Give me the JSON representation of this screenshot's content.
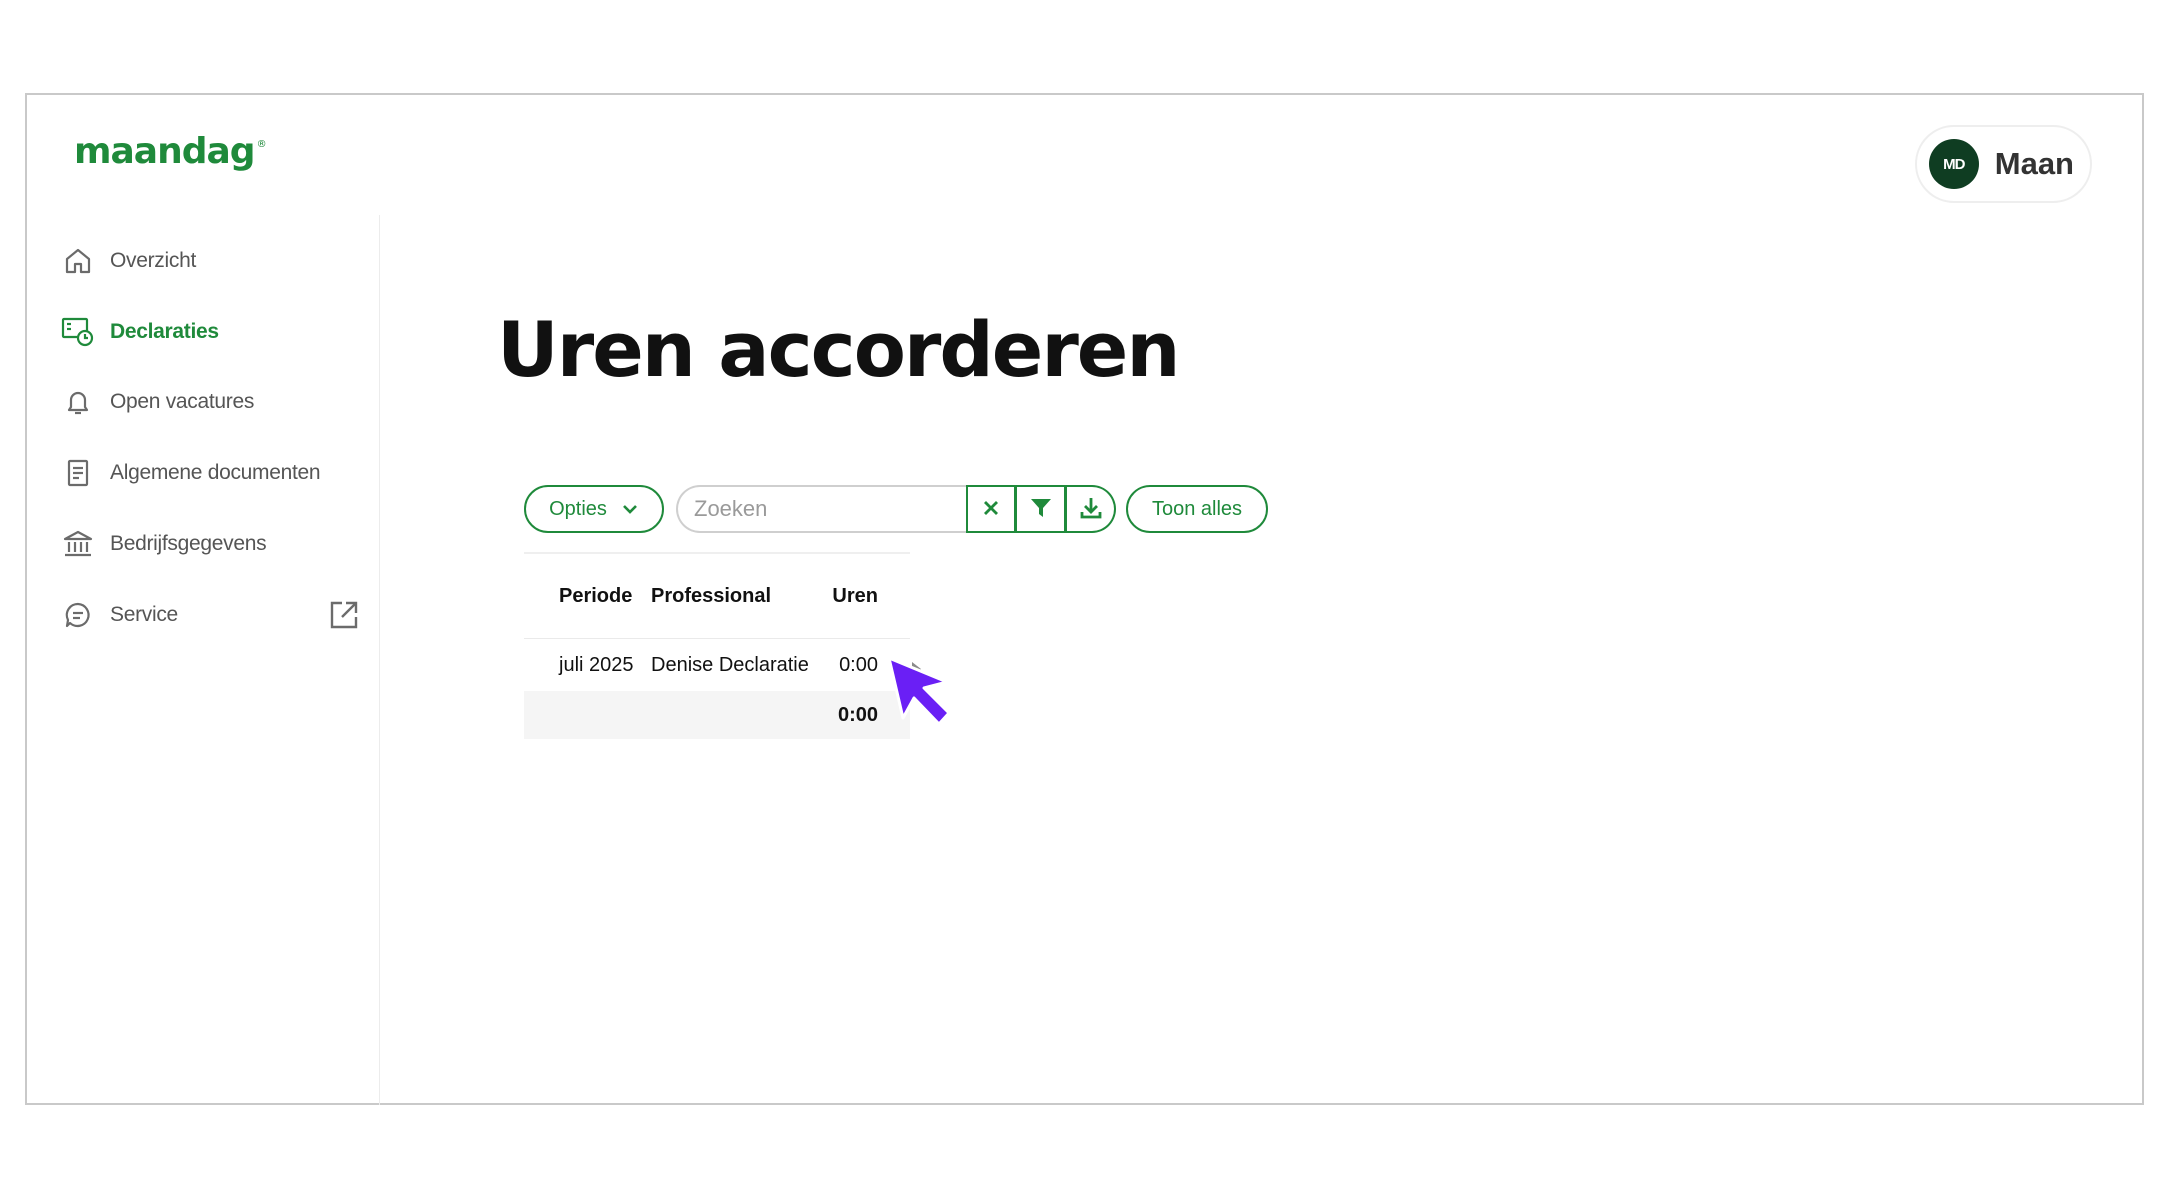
{
  "brand": {
    "logo_text": "maandag",
    "logo_mark": "®",
    "accent": "#1f8a3b"
  },
  "user": {
    "initials": "MD",
    "name": "Maan"
  },
  "sidebar": {
    "items": [
      {
        "label": "Overzicht",
        "icon": "home-icon",
        "active": false
      },
      {
        "label": "Declaraties",
        "icon": "timesheet-clock-icon",
        "active": true
      },
      {
        "label": "Open vacatures",
        "icon": "bell-icon",
        "active": false
      },
      {
        "label": "Algemene documenten",
        "icon": "document-icon",
        "active": false
      },
      {
        "label": "Bedrijfsgegevens",
        "icon": "building-icon",
        "active": false
      },
      {
        "label": "Service",
        "icon": "chat-icon",
        "active": false,
        "external": true
      }
    ]
  },
  "main": {
    "title": "Uren accorderen"
  },
  "toolbar": {
    "options_label": "Opties",
    "search_placeholder": "Zoeken",
    "show_all_label": "Toon alles"
  },
  "table": {
    "columns": [
      "Periode",
      "Professional",
      "Uren"
    ],
    "rows": [
      {
        "periode": "juli 2025",
        "professional": "Denise Declaratie",
        "uren": "0:00"
      }
    ],
    "total": "0:00"
  },
  "cursor": {
    "color": "#6a1ff5"
  }
}
